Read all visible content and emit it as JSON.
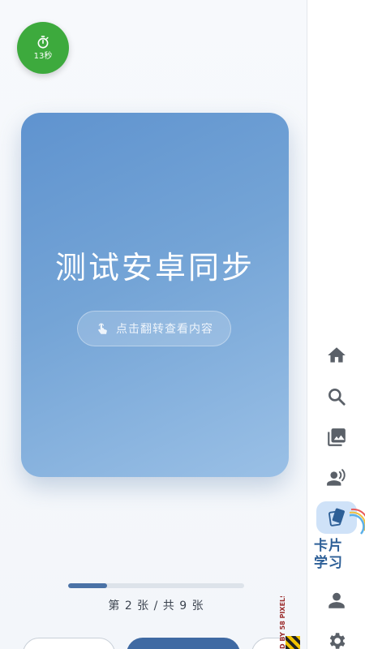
{
  "timer": {
    "text": "13秒",
    "icon": "stopwatch-icon"
  },
  "card": {
    "title": "测试安卓同步",
    "flip_hint": "点击翻转查看内容",
    "hint_icon": "touch-icon"
  },
  "progress": {
    "text": "第 2 张 / 共 9 张",
    "current": 2,
    "total": 9,
    "fraction": 0.22
  },
  "watermark": {
    "text": "D BY 58 PIXELS"
  },
  "nav": {
    "items": [
      {
        "icon": "home-icon"
      },
      {
        "icon": "search-icon"
      },
      {
        "icon": "image-icon"
      },
      {
        "icon": "voice-speaker-icon"
      },
      {
        "icon": "flashcard-icon",
        "label_line1": "卡片",
        "label_line2": "学习",
        "active": true
      },
      {
        "icon": "person-icon"
      },
      {
        "icon": "gear-icon"
      }
    ]
  },
  "colors": {
    "timer": "#3daa3d",
    "card_start": "#5f93cf",
    "card_end": "#9ac0e6",
    "accent": "#3f6aa3",
    "nav_active_bg": "#cfe2f8",
    "nav_icon": "#5a6068"
  }
}
